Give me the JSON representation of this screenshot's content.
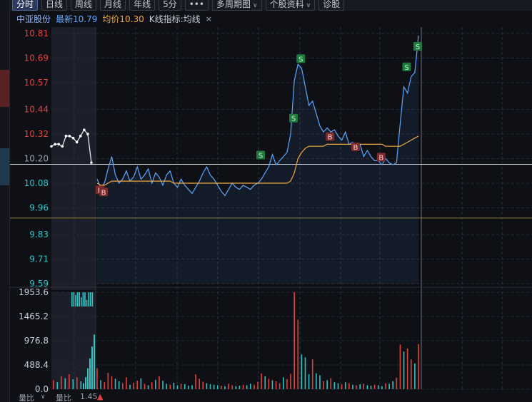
{
  "toolbar": {
    "tabs": [
      {
        "label": "分时",
        "active": true
      },
      {
        "label": "日线"
      },
      {
        "label": "周线"
      },
      {
        "label": "月线"
      },
      {
        "label": "年线"
      },
      {
        "label": "5分"
      },
      {
        "label": "•••"
      },
      {
        "label": "多周期图",
        "dropdown": true
      },
      {
        "label": "个股资料",
        "dropdown": true
      },
      {
        "label": "诊股"
      }
    ]
  },
  "info": {
    "stock_name": "中亚股份",
    "latest_label": "最新",
    "latest_value": "10.79",
    "avg_label": "均价",
    "avg_value": "10.30",
    "indicator": "K线指标:均线",
    "close_icon": "×"
  },
  "footer": {
    "item1": "量比",
    "item2": "量比",
    "value": "1.45",
    "arrow": "▲"
  },
  "colors": {
    "price_line": "#5aa7ff",
    "avg_line": "#f0a93a",
    "up": "#e0433d",
    "down": "#2ec4c4",
    "neutral": "#9aa0ab",
    "sell_marker": "#1f7a3e",
    "buy_marker": "#7a2a2e"
  },
  "chart_data": [
    {
      "type": "line",
      "y_ticks": [
        {
          "label": "10.81",
          "color": "up"
        },
        {
          "label": "10.69",
          "color": "up"
        },
        {
          "label": "10.57",
          "color": "up"
        },
        {
          "label": "10.44",
          "color": "up"
        },
        {
          "label": "10.32",
          "color": "up"
        },
        {
          "label": "10.20",
          "color": "neutral"
        },
        {
          "label": "10.08",
          "color": "down"
        },
        {
          "label": "9.96",
          "color": "down"
        },
        {
          "label": "9.83",
          "color": "down"
        },
        {
          "label": "9.71",
          "color": "down"
        },
        {
          "label": "9.59",
          "color": "down"
        }
      ],
      "ylim": [
        9.59,
        10.81
      ],
      "reference_price": 10.2,
      "auction_prices": [
        10.26,
        10.27,
        10.27,
        10.26,
        10.31,
        10.31,
        10.3,
        10.28,
        10.31,
        10.34,
        10.32,
        10.18
      ],
      "price_series": [
        10.1,
        10.06,
        10.08,
        10.15,
        10.21,
        10.12,
        10.08,
        10.1,
        10.14,
        10.09,
        10.11,
        10.16,
        10.1,
        10.12,
        10.15,
        10.08,
        10.13,
        10.11,
        10.07,
        10.12,
        10.14,
        10.08,
        10.06,
        10.1,
        10.07,
        10.05,
        10.03,
        10.06,
        10.09,
        10.13,
        10.16,
        10.12,
        10.1,
        10.07,
        10.04,
        10.02,
        10.05,
        10.08,
        10.06,
        10.05,
        10.07,
        10.06,
        10.05,
        10.07,
        10.08,
        10.1,
        10.13,
        10.16,
        10.22,
        10.17,
        10.19,
        10.21,
        10.23,
        10.32,
        10.58,
        10.66,
        10.64,
        10.55,
        10.46,
        10.48,
        10.42,
        10.36,
        10.33,
        10.35,
        10.33,
        10.34,
        10.31,
        10.29,
        10.33,
        10.27,
        10.28,
        10.24,
        10.27,
        10.21,
        10.24,
        10.21,
        10.19,
        10.19,
        10.17,
        10.2,
        10.18,
        10.17,
        10.18,
        10.37,
        10.55,
        10.52,
        10.6,
        10.62,
        10.8
      ],
      "avg_series": [
        10.08,
        10.07,
        10.07,
        10.08,
        10.09,
        10.09,
        10.09,
        10.09,
        10.09,
        10.09,
        10.09,
        10.09,
        10.09,
        10.09,
        10.09,
        10.09,
        10.09,
        10.09,
        10.09,
        10.09,
        10.09,
        10.08,
        10.08,
        10.08,
        10.08,
        10.08,
        10.08,
        10.08,
        10.08,
        10.08,
        10.08,
        10.08,
        10.08,
        10.08,
        10.08,
        10.08,
        10.08,
        10.08,
        10.08,
        10.08,
        10.08,
        10.08,
        10.08,
        10.08,
        10.08,
        10.08,
        10.08,
        10.08,
        10.08,
        10.08,
        10.08,
        10.08,
        10.08,
        10.09,
        10.13,
        10.2,
        10.23,
        10.25,
        10.26,
        10.26,
        10.26,
        10.26,
        10.26,
        10.27,
        10.27,
        10.27,
        10.27,
        10.27,
        10.27,
        10.27,
        10.27,
        10.27,
        10.27,
        10.27,
        10.27,
        10.27,
        10.27,
        10.27,
        10.27,
        10.26,
        10.26,
        10.26,
        10.26,
        10.26,
        10.27,
        10.28,
        10.29,
        10.3,
        10.31
      ],
      "markers": [
        {
          "label": "E",
          "kind": "buy",
          "index": 0,
          "price": 10.03
        },
        {
          "label": "B",
          "kind": "buy",
          "index": 1,
          "price": 10.02
        },
        {
          "label": "S",
          "kind": "sell",
          "index": 44,
          "price": 10.2
        },
        {
          "label": "S",
          "kind": "sell",
          "index": 53,
          "price": 10.38
        },
        {
          "label": "S",
          "kind": "sell",
          "index": 55,
          "price": 10.67
        },
        {
          "label": "B",
          "kind": "buy",
          "index": 63,
          "price": 10.29
        },
        {
          "label": "B",
          "kind": "buy",
          "index": 70,
          "price": 10.24
        },
        {
          "label": "B",
          "kind": "buy",
          "index": 77,
          "price": 10.19
        },
        {
          "label": "S",
          "kind": "sell",
          "index": 84,
          "price": 10.63
        },
        {
          "label": "S",
          "kind": "sell",
          "index": 87,
          "price": 10.73
        }
      ]
    },
    {
      "type": "bar",
      "y_ticks": [
        "1953.6",
        "1465.2",
        "976.8",
        "488.4",
        "0.0"
      ],
      "ylim": [
        0,
        1953.6
      ],
      "auction_volumes": [
        1953.6,
        1953.6,
        1900,
        1953.6,
        1953.6,
        1850,
        1953.6,
        1953.6,
        1800,
        1953.6,
        1953.6,
        1953.6
      ],
      "volumes": [
        420,
        180,
        140,
        330,
        260,
        210,
        160,
        120,
        240,
        90,
        130,
        170,
        220,
        110,
        80,
        140,
        190,
        260,
        170,
        110,
        90,
        130,
        80,
        110,
        100,
        70,
        80,
        300,
        210,
        150,
        120,
        100,
        90,
        80,
        70,
        60,
        110,
        80,
        60,
        70,
        90,
        80,
        110,
        90,
        150,
        320,
        260,
        210,
        180,
        160,
        120,
        240,
        200,
        310,
        1953.6,
        1400,
        700,
        640,
        300,
        600,
        320,
        280,
        160,
        180,
        220,
        140,
        120,
        100,
        140,
        120,
        90,
        80,
        100,
        110,
        80,
        70,
        90,
        80,
        60,
        120,
        110,
        160,
        230,
        900,
        760,
        820,
        600,
        520,
        910
      ],
      "volume_directions": [
        "up",
        "down",
        "up",
        "up",
        "up",
        "down",
        "down",
        "up",
        "up",
        "down",
        "up",
        "up",
        "down",
        "up",
        "down",
        "up",
        "down",
        "up",
        "down",
        "down",
        "up",
        "down",
        "down",
        "up",
        "down",
        "down",
        "down",
        "up",
        "up",
        "up",
        "down",
        "down",
        "down",
        "down",
        "up",
        "down",
        "up",
        "up",
        "down",
        "down",
        "up",
        "down",
        "down",
        "up",
        "up",
        "up",
        "down",
        "up",
        "down",
        "up",
        "up",
        "down",
        "up",
        "up",
        "up",
        "up",
        "down",
        "down",
        "down",
        "up",
        "down",
        "down",
        "up",
        "down",
        "up",
        "down",
        "down",
        "up",
        "down",
        "up",
        "down",
        "up",
        "down",
        "up",
        "down",
        "down",
        "up",
        "down",
        "down",
        "up",
        "down",
        "down",
        "up",
        "up",
        "down",
        "up",
        "up",
        "down",
        "up"
      ]
    }
  ]
}
